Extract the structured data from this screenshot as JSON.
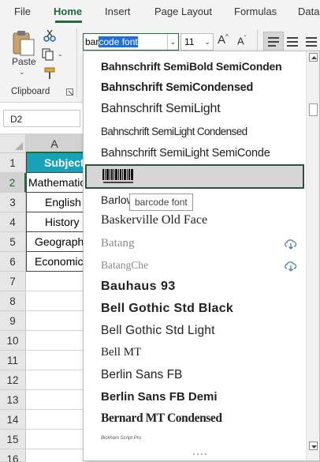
{
  "ribbon_tabs": [
    "File",
    "Home",
    "Insert",
    "Page Layout",
    "Formulas",
    "Data"
  ],
  "active_tab": "Home",
  "clipboard": {
    "paste_label": "Paste",
    "group_label": "Clipboard"
  },
  "font_box": {
    "value_prefix": "bar",
    "value_selected": "code font",
    "value": "barcode font"
  },
  "size_box": {
    "value": "11"
  },
  "name_box": {
    "value": "D2"
  },
  "columns": [
    "A"
  ],
  "rows": [
    "1",
    "2",
    "3",
    "4",
    "5",
    "6",
    "7",
    "8",
    "9",
    "10",
    "11",
    "12",
    "13",
    "14",
    "15",
    "16"
  ],
  "cells": [
    "Subject",
    "Mathematics",
    "English",
    "History",
    "Geography",
    "Economics"
  ],
  "font_list": [
    "Bahnschrift SemiBold SemiConden",
    "Bahnschrift SemiCondensed",
    "Bahnschrift SemiLight",
    "Bahnschrift SemiLight Condensed",
    "Bahnschrift SemiLight SemiConde",
    "",
    "Barlow",
    "Baskerville Old Face",
    "Batang",
    "BatangChe",
    "Bauhaus 93",
    "Bell Gothic Std Black",
    "Bell Gothic Std Light",
    "Bell MT",
    "Berlin Sans FB",
    "Berlin Sans FB Demi",
    "Bernard MT Condensed",
    "Bickham Script Pro"
  ],
  "tooltip": "barcode font",
  "colors": {
    "accent": "#1e6b3a",
    "header_fill": "#17a2b8",
    "selection": "#1f6fd6"
  }
}
